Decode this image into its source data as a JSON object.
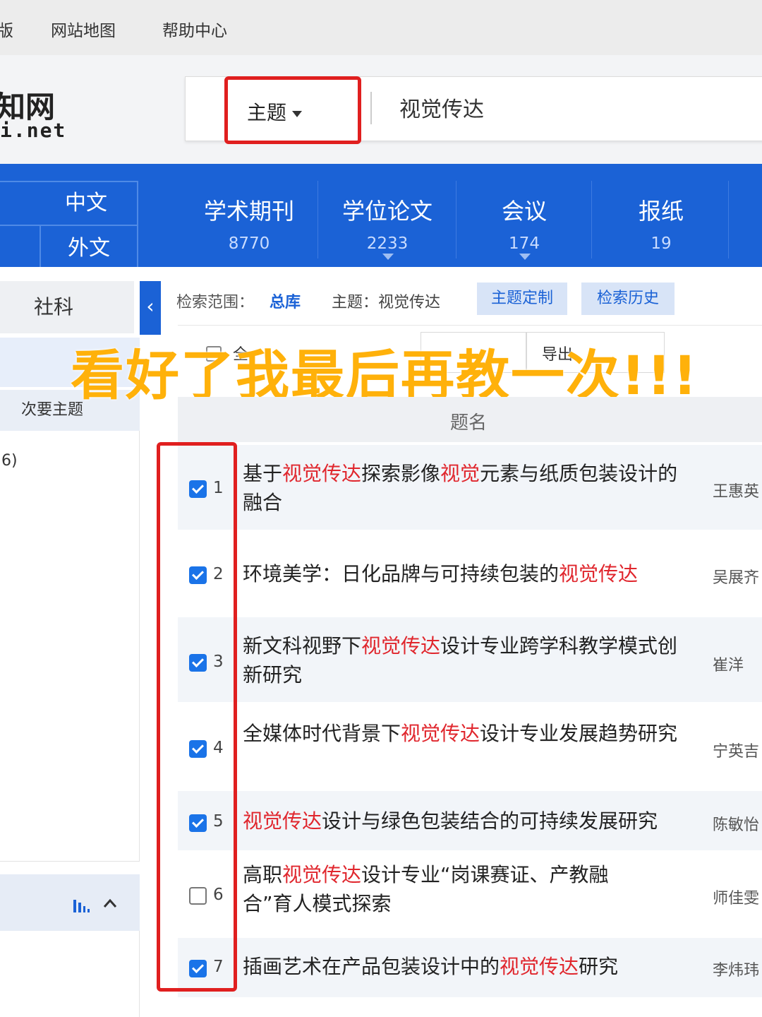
{
  "topnav": [
    "版",
    "网站地图",
    "帮助中心"
  ],
  "logo": {
    "cn": "知网",
    "en": "i.net"
  },
  "search": {
    "field": "主题",
    "query": "视觉传达"
  },
  "language_tabs": {
    "cn": "中文",
    "foreign": "外文"
  },
  "databases": [
    {
      "name": "学术期刊",
      "count": "8770"
    },
    {
      "name": "学位论文",
      "count": "2233"
    },
    {
      "name": "会议",
      "count": "174"
    },
    {
      "name": "报纸",
      "count": "19"
    }
  ],
  "sidebar": {
    "category": "社科",
    "collapse_glyph": "‹",
    "minor_topic": "次要主题",
    "partial_count": "6)"
  },
  "filter": {
    "scope_label": "检索范围：",
    "scope_value": "总库",
    "topic": "主题：视觉传达",
    "custom_button": "主题定制",
    "history_button": "检索历史"
  },
  "toolbar": {
    "select_all": "全",
    "export": "导出"
  },
  "overlay_caption": "看好了我最后再教一次!!!",
  "table": {
    "header_title": "题名",
    "rows": [
      {
        "n": "1",
        "checked": true,
        "parts": [
          "基于",
          "视觉传达",
          "探索影像",
          "视觉",
          "元素与纸质包装设计的融合"
        ],
        "author": "王惠英"
      },
      {
        "n": "2",
        "checked": true,
        "parts": [
          "环境美学：日化品牌与可持续包装的",
          "视觉传达"
        ],
        "author": "吴展齐"
      },
      {
        "n": "3",
        "checked": true,
        "parts": [
          "新文科视野下",
          "视觉传达",
          "设计专业跨学科教学模式创新研究"
        ],
        "author": "崔洋"
      },
      {
        "n": "4",
        "checked": true,
        "parts": [
          "全媒体时代背景下",
          "视觉传达",
          "设计专业发展趋势研究"
        ],
        "author": "宁英吉"
      },
      {
        "n": "5",
        "checked": true,
        "parts": [
          "",
          "视觉传达",
          "设计与绿色包装结合的可持续发展研究"
        ],
        "author": "陈敏怡"
      },
      {
        "n": "6",
        "checked": false,
        "parts": [
          "高职",
          "视觉传达",
          "设计专业“岗课赛证、产教融合”育人模式探索"
        ],
        "author": "师佳雯"
      },
      {
        "n": "7",
        "checked": true,
        "parts": [
          "插画艺术在产品包装设计中的",
          "视觉传达",
          "研究"
        ],
        "author": "李炜玮"
      }
    ]
  }
}
